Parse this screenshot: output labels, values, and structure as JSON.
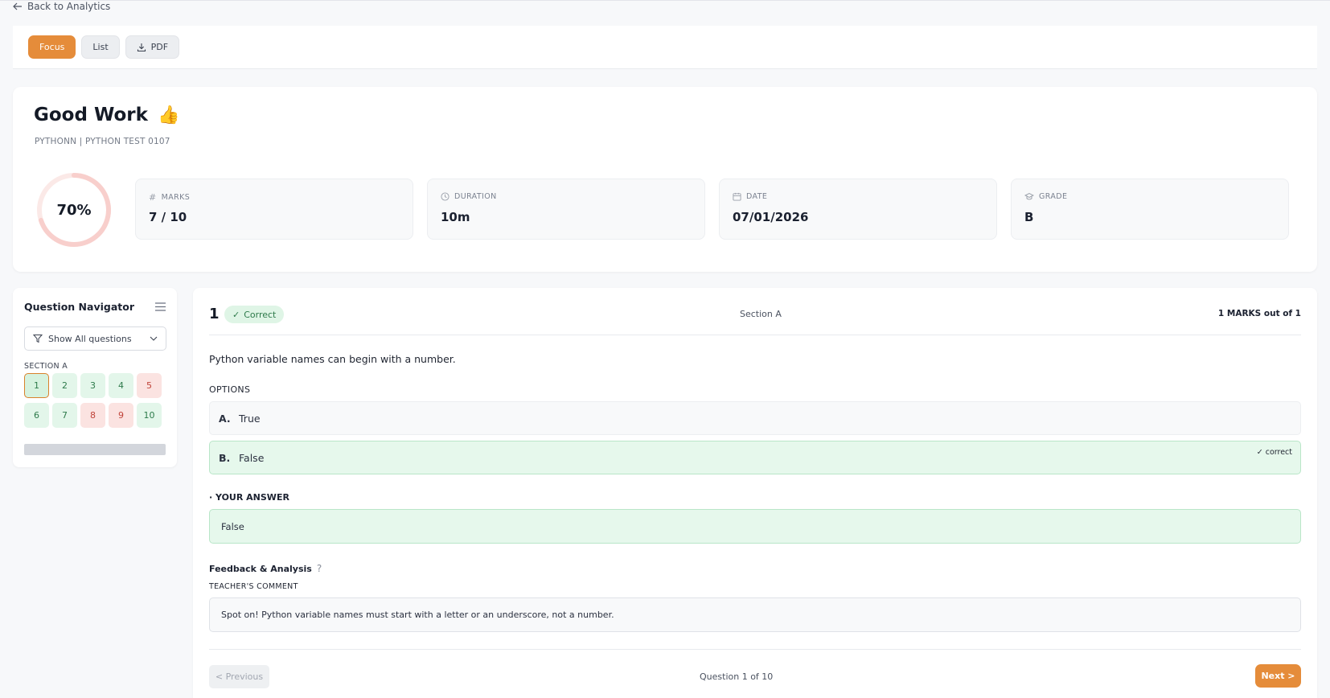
{
  "nav": {
    "back_label": "Back to Analytics"
  },
  "toolbar": {
    "focus_label": "Focus",
    "list_label": "List",
    "pdf_label": "PDF"
  },
  "summary": {
    "title": "Good Work",
    "emoji": "👍",
    "subtitle": "PYTHONN | PYTHON TEST 0107",
    "score_percent": 70,
    "score_label": "70%",
    "stats": [
      {
        "label": "MARKS",
        "value": "7 / 10",
        "icon": "hash-icon"
      },
      {
        "label": "DURATION",
        "value": "10m",
        "icon": "clock-icon"
      },
      {
        "label": "DATE",
        "value": "07/01/2026",
        "icon": "calendar-icon"
      },
      {
        "label": "GRADE",
        "value": "B",
        "icon": "graduation-cap-icon"
      }
    ]
  },
  "navigator": {
    "title": "Question Navigator",
    "filter_label": "Show All questions",
    "section_label": "SECTION A",
    "questions": [
      {
        "num": "1",
        "status": "correct",
        "current": true
      },
      {
        "num": "2",
        "status": "correct"
      },
      {
        "num": "3",
        "status": "correct"
      },
      {
        "num": "4",
        "status": "correct"
      },
      {
        "num": "5",
        "status": "incorrect"
      },
      {
        "num": "6",
        "status": "correct"
      },
      {
        "num": "7",
        "status": "correct"
      },
      {
        "num": "8",
        "status": "incorrect"
      },
      {
        "num": "9",
        "status": "incorrect"
      },
      {
        "num": "10",
        "status": "correct"
      }
    ]
  },
  "question": {
    "number": "1",
    "badge": "Correct",
    "section": "Section A",
    "marks": "1 MARKS out of 1",
    "text": "Python variable names can begin with a number.",
    "options_label": "OPTIONS",
    "options": [
      {
        "letter": "A.",
        "text": "True"
      },
      {
        "letter": "B.",
        "text": "False",
        "tag": "✓ correct"
      }
    ],
    "your_answer_label": "· YOUR ANSWER",
    "your_answer": "False",
    "feedback_title": "Feedback & Analysis",
    "feedback_help": "?",
    "teacher_comment_label": "TEACHER'S COMMENT",
    "teacher_comment": "Spot on! Python variable names must start with a letter or an underscore, not a number."
  },
  "pager": {
    "prev_label": "< Previous",
    "position": "Question 1 of 10",
    "next_label": "Next >"
  },
  "colors": {
    "accent": "#e58c3a",
    "correct_bg": "#e3f6ea",
    "incorrect_bg": "#fbe3e1",
    "ring": "#f8cfcc"
  }
}
